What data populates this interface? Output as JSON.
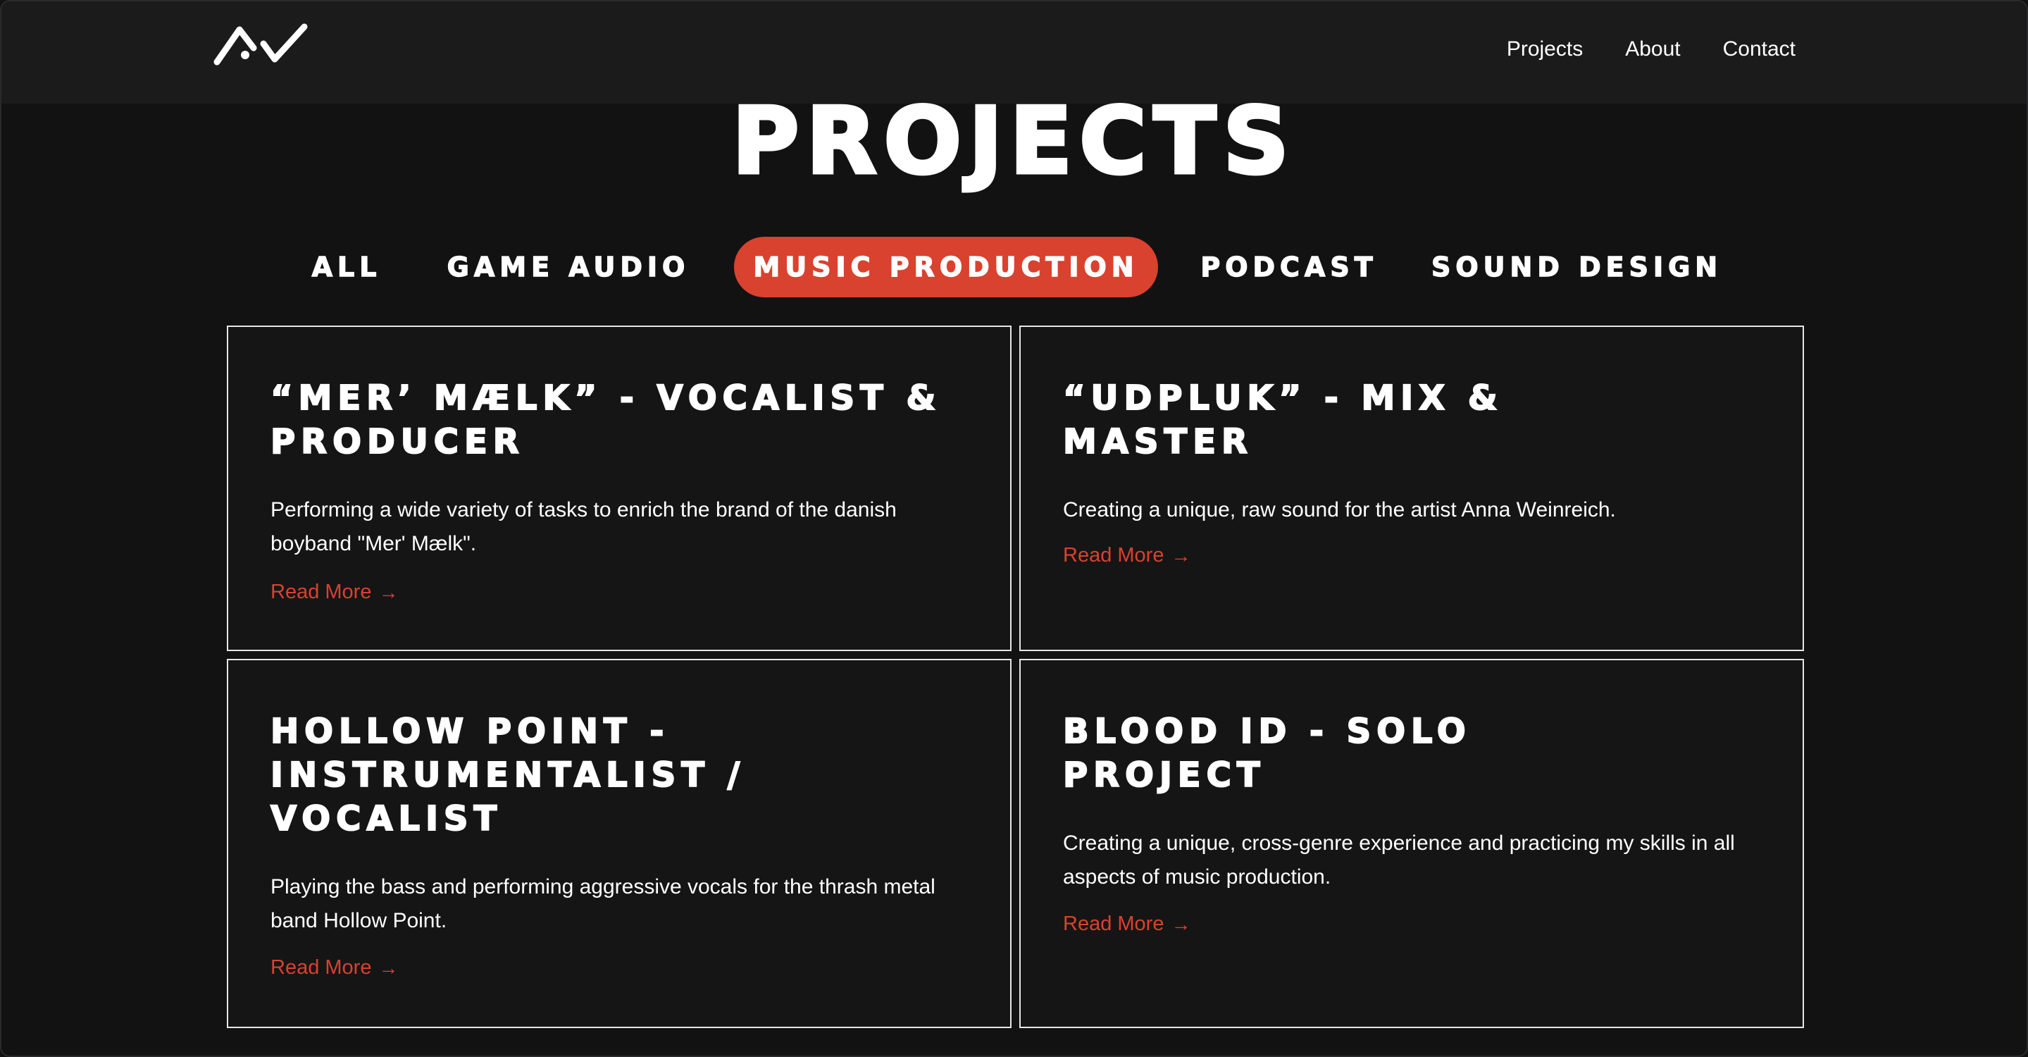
{
  "header": {
    "logo_name": "logo-icon",
    "nav": [
      {
        "label": "Projects"
      },
      {
        "label": "About"
      },
      {
        "label": "Contact"
      }
    ]
  },
  "main": {
    "title": "PROJECTS",
    "filters": [
      {
        "label": "ALL",
        "active": false
      },
      {
        "label": "GAME AUDIO",
        "active": false
      },
      {
        "label": "MUSIC PRODUCTION",
        "active": true
      },
      {
        "label": "PODCAST",
        "active": false
      },
      {
        "label": "SOUND DESIGN",
        "active": false
      }
    ],
    "projects": [
      {
        "title": "“MER’ MÆLK” - VOCALIST & PRODUCER",
        "description": "Performing a wide variety of tasks to enrich the brand of the danish boyband \"Mer' Mælk\".",
        "link": "Read More"
      },
      {
        "title": "“UDPLUK” - MIX & MASTER",
        "description": "Creating a unique, raw sound for the artist Anna Weinreich.",
        "link": "Read More"
      },
      {
        "title": "HOLLOW POINT - INSTRUMENTALIST / VOCALIST",
        "description": "Playing the bass and performing aggressive vocals for the thrash metal band Hollow Point.",
        "link": "Read More"
      },
      {
        "title": "BLOOD ID - SOLO PROJECT",
        "description": "Creating a unique, cross-genre experience and practicing my skills in all aspects of music production.",
        "link": "Read More"
      }
    ]
  },
  "colors": {
    "background": "#121213",
    "header": "#1b1b1c",
    "accent": "#d9422e",
    "text": "#ffffff"
  }
}
